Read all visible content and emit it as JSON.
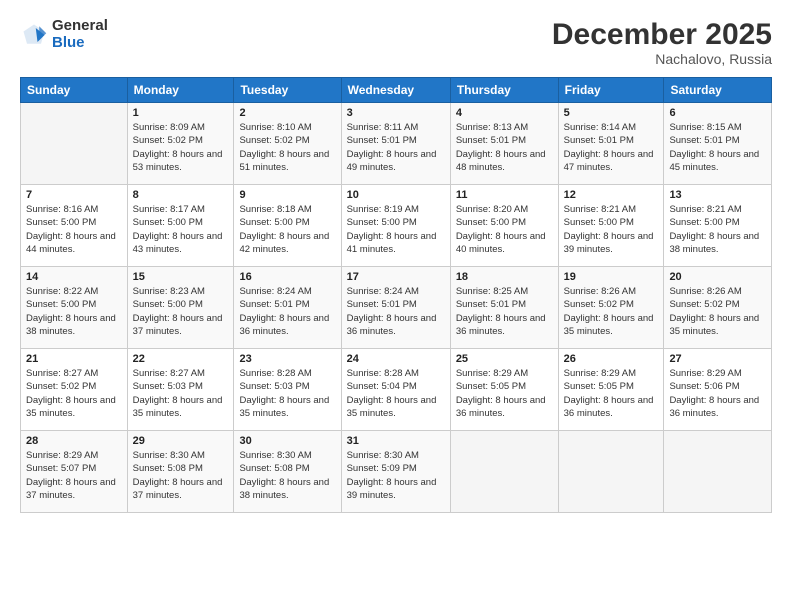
{
  "logo": {
    "general": "General",
    "blue": "Blue"
  },
  "title": "December 2025",
  "location": "Nachalovo, Russia",
  "days_header": [
    "Sunday",
    "Monday",
    "Tuesday",
    "Wednesday",
    "Thursday",
    "Friday",
    "Saturday"
  ],
  "weeks": [
    [
      {
        "day": "",
        "sunrise": "",
        "sunset": "",
        "daylight": ""
      },
      {
        "day": "1",
        "sunrise": "Sunrise: 8:09 AM",
        "sunset": "Sunset: 5:02 PM",
        "daylight": "Daylight: 8 hours and 53 minutes."
      },
      {
        "day": "2",
        "sunrise": "Sunrise: 8:10 AM",
        "sunset": "Sunset: 5:02 PM",
        "daylight": "Daylight: 8 hours and 51 minutes."
      },
      {
        "day": "3",
        "sunrise": "Sunrise: 8:11 AM",
        "sunset": "Sunset: 5:01 PM",
        "daylight": "Daylight: 8 hours and 49 minutes."
      },
      {
        "day": "4",
        "sunrise": "Sunrise: 8:13 AM",
        "sunset": "Sunset: 5:01 PM",
        "daylight": "Daylight: 8 hours and 48 minutes."
      },
      {
        "day": "5",
        "sunrise": "Sunrise: 8:14 AM",
        "sunset": "Sunset: 5:01 PM",
        "daylight": "Daylight: 8 hours and 47 minutes."
      },
      {
        "day": "6",
        "sunrise": "Sunrise: 8:15 AM",
        "sunset": "Sunset: 5:01 PM",
        "daylight": "Daylight: 8 hours and 45 minutes."
      }
    ],
    [
      {
        "day": "7",
        "sunrise": "Sunrise: 8:16 AM",
        "sunset": "Sunset: 5:00 PM",
        "daylight": "Daylight: 8 hours and 44 minutes."
      },
      {
        "day": "8",
        "sunrise": "Sunrise: 8:17 AM",
        "sunset": "Sunset: 5:00 PM",
        "daylight": "Daylight: 8 hours and 43 minutes."
      },
      {
        "day": "9",
        "sunrise": "Sunrise: 8:18 AM",
        "sunset": "Sunset: 5:00 PM",
        "daylight": "Daylight: 8 hours and 42 minutes."
      },
      {
        "day": "10",
        "sunrise": "Sunrise: 8:19 AM",
        "sunset": "Sunset: 5:00 PM",
        "daylight": "Daylight: 8 hours and 41 minutes."
      },
      {
        "day": "11",
        "sunrise": "Sunrise: 8:20 AM",
        "sunset": "Sunset: 5:00 PM",
        "daylight": "Daylight: 8 hours and 40 minutes."
      },
      {
        "day": "12",
        "sunrise": "Sunrise: 8:21 AM",
        "sunset": "Sunset: 5:00 PM",
        "daylight": "Daylight: 8 hours and 39 minutes."
      },
      {
        "day": "13",
        "sunrise": "Sunrise: 8:21 AM",
        "sunset": "Sunset: 5:00 PM",
        "daylight": "Daylight: 8 hours and 38 minutes."
      }
    ],
    [
      {
        "day": "14",
        "sunrise": "Sunrise: 8:22 AM",
        "sunset": "Sunset: 5:00 PM",
        "daylight": "Daylight: 8 hours and 38 minutes."
      },
      {
        "day": "15",
        "sunrise": "Sunrise: 8:23 AM",
        "sunset": "Sunset: 5:00 PM",
        "daylight": "Daylight: 8 hours and 37 minutes."
      },
      {
        "day": "16",
        "sunrise": "Sunrise: 8:24 AM",
        "sunset": "Sunset: 5:01 PM",
        "daylight": "Daylight: 8 hours and 36 minutes."
      },
      {
        "day": "17",
        "sunrise": "Sunrise: 8:24 AM",
        "sunset": "Sunset: 5:01 PM",
        "daylight": "Daylight: 8 hours and 36 minutes."
      },
      {
        "day": "18",
        "sunrise": "Sunrise: 8:25 AM",
        "sunset": "Sunset: 5:01 PM",
        "daylight": "Daylight: 8 hours and 36 minutes."
      },
      {
        "day": "19",
        "sunrise": "Sunrise: 8:26 AM",
        "sunset": "Sunset: 5:02 PM",
        "daylight": "Daylight: 8 hours and 35 minutes."
      },
      {
        "day": "20",
        "sunrise": "Sunrise: 8:26 AM",
        "sunset": "Sunset: 5:02 PM",
        "daylight": "Daylight: 8 hours and 35 minutes."
      }
    ],
    [
      {
        "day": "21",
        "sunrise": "Sunrise: 8:27 AM",
        "sunset": "Sunset: 5:02 PM",
        "daylight": "Daylight: 8 hours and 35 minutes."
      },
      {
        "day": "22",
        "sunrise": "Sunrise: 8:27 AM",
        "sunset": "Sunset: 5:03 PM",
        "daylight": "Daylight: 8 hours and 35 minutes."
      },
      {
        "day": "23",
        "sunrise": "Sunrise: 8:28 AM",
        "sunset": "Sunset: 5:03 PM",
        "daylight": "Daylight: 8 hours and 35 minutes."
      },
      {
        "day": "24",
        "sunrise": "Sunrise: 8:28 AM",
        "sunset": "Sunset: 5:04 PM",
        "daylight": "Daylight: 8 hours and 35 minutes."
      },
      {
        "day": "25",
        "sunrise": "Sunrise: 8:29 AM",
        "sunset": "Sunset: 5:05 PM",
        "daylight": "Daylight: 8 hours and 36 minutes."
      },
      {
        "day": "26",
        "sunrise": "Sunrise: 8:29 AM",
        "sunset": "Sunset: 5:05 PM",
        "daylight": "Daylight: 8 hours and 36 minutes."
      },
      {
        "day": "27",
        "sunrise": "Sunrise: 8:29 AM",
        "sunset": "Sunset: 5:06 PM",
        "daylight": "Daylight: 8 hours and 36 minutes."
      }
    ],
    [
      {
        "day": "28",
        "sunrise": "Sunrise: 8:29 AM",
        "sunset": "Sunset: 5:07 PM",
        "daylight": "Daylight: 8 hours and 37 minutes."
      },
      {
        "day": "29",
        "sunrise": "Sunrise: 8:30 AM",
        "sunset": "Sunset: 5:08 PM",
        "daylight": "Daylight: 8 hours and 37 minutes."
      },
      {
        "day": "30",
        "sunrise": "Sunrise: 8:30 AM",
        "sunset": "Sunset: 5:08 PM",
        "daylight": "Daylight: 8 hours and 38 minutes."
      },
      {
        "day": "31",
        "sunrise": "Sunrise: 8:30 AM",
        "sunset": "Sunset: 5:09 PM",
        "daylight": "Daylight: 8 hours and 39 minutes."
      },
      {
        "day": "",
        "sunrise": "",
        "sunset": "",
        "daylight": ""
      },
      {
        "day": "",
        "sunrise": "",
        "sunset": "",
        "daylight": ""
      },
      {
        "day": "",
        "sunrise": "",
        "sunset": "",
        "daylight": ""
      }
    ]
  ]
}
